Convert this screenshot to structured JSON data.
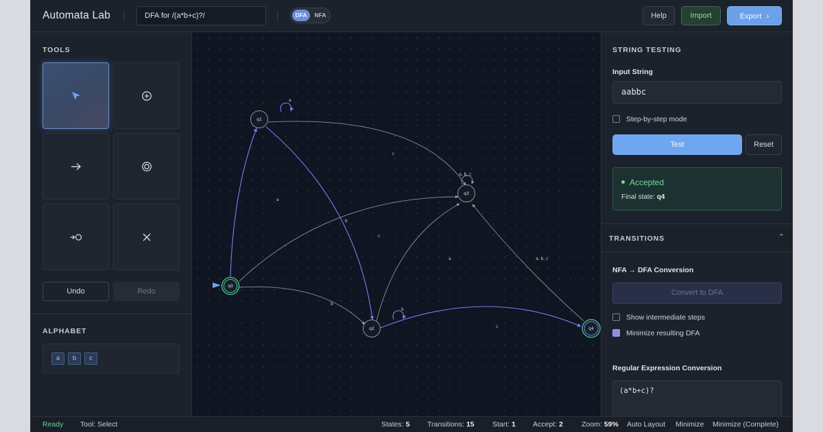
{
  "header": {
    "app_title": "Automata Lab",
    "automaton_name": "DFA for /(a*b+c)?/",
    "mode_dfa": "DFA",
    "mode_nfa": "NFA",
    "help_label": "Help",
    "import_label": "Import",
    "export_label": "Export"
  },
  "tools": {
    "title": "TOOLS",
    "items": [
      {
        "name": "select",
        "icon": "cursor-icon",
        "active": true
      },
      {
        "name": "add-state",
        "icon": "plus-circle-icon",
        "active": false
      },
      {
        "name": "add-transition",
        "icon": "arrow-right-icon",
        "active": false
      },
      {
        "name": "accept-state",
        "icon": "double-circle-icon",
        "active": false
      },
      {
        "name": "start-state",
        "icon": "start-arrow-icon",
        "active": false
      },
      {
        "name": "delete",
        "icon": "close-icon",
        "active": false
      }
    ],
    "undo_label": "Undo",
    "redo_label": "Redo"
  },
  "alphabet": {
    "title": "ALPHABET",
    "symbols": [
      "a",
      "b",
      "c"
    ]
  },
  "graph": {
    "states": [
      {
        "id": "q0",
        "start": true,
        "accept": true
      },
      {
        "id": "q1",
        "start": false,
        "accept": false
      },
      {
        "id": "q2",
        "start": false,
        "accept": false
      },
      {
        "id": "q3",
        "start": false,
        "accept": false
      },
      {
        "id": "q4",
        "start": false,
        "accept": true
      }
    ],
    "transitions": [
      {
        "from": "q0",
        "to": "q1",
        "label": "a",
        "highlighted": true
      },
      {
        "from": "q0",
        "to": "q3",
        "label": "b",
        "highlighted": false
      },
      {
        "from": "q0",
        "to": "q2",
        "label": "b",
        "highlighted": false
      },
      {
        "from": "q1",
        "to": "q1",
        "label": "a",
        "highlighted": true
      },
      {
        "from": "q1",
        "to": "q3",
        "label": "c",
        "highlighted": false
      },
      {
        "from": "q1",
        "to": "q2",
        "label": "c",
        "highlighted": true
      },
      {
        "from": "q2",
        "to": "q2",
        "label": "b",
        "highlighted": true
      },
      {
        "from": "q2",
        "to": "q3",
        "label": "a",
        "highlighted": false
      },
      {
        "from": "q2",
        "to": "q4",
        "label": "c",
        "highlighted": true
      },
      {
        "from": "q3",
        "to": "q3",
        "label": "a, b, c",
        "highlighted": false
      },
      {
        "from": "q4",
        "to": "q3",
        "label": "a, b, c",
        "highlighted": false
      }
    ]
  },
  "testing": {
    "title": "STRING TESTING",
    "input_label": "Input String",
    "input_value": "aabbc",
    "step_mode_label": "Step-by-step mode",
    "step_mode_checked": false,
    "test_label": "Test",
    "reset_label": "Reset",
    "result_status": "Accepted",
    "final_state_label": "Final state:",
    "final_state": "q4"
  },
  "transitions_panel": {
    "title": "TRANSITIONS",
    "nfa_dfa_title": "NFA → DFA Conversion",
    "convert_label": "Convert to DFA",
    "show_steps_label": "Show intermediate steps",
    "show_steps_checked": false,
    "minimize_label": "Minimize resulting DFA",
    "minimize_checked": true,
    "regex_title": "Regular Expression Conversion",
    "regex_value": "(a*b+c)?"
  },
  "status_bar": {
    "ready": "Ready",
    "tool": "Tool: Select",
    "states_label": "States:",
    "states": "5",
    "transitions_label": "Transitions:",
    "transitions": "15",
    "start_label": "Start:",
    "start": "1",
    "accept_label": "Accept:",
    "accept": "2",
    "zoom_label": "Zoom:",
    "zoom": "59%",
    "auto_layout": "Auto Layout",
    "minimize": "Minimize",
    "minimize_complete": "Minimize (Complete)"
  },
  "colors": {
    "accent": "#6fa6f0",
    "highlight_edge": "#7c7ef0",
    "accept_green": "#6ddca0"
  }
}
